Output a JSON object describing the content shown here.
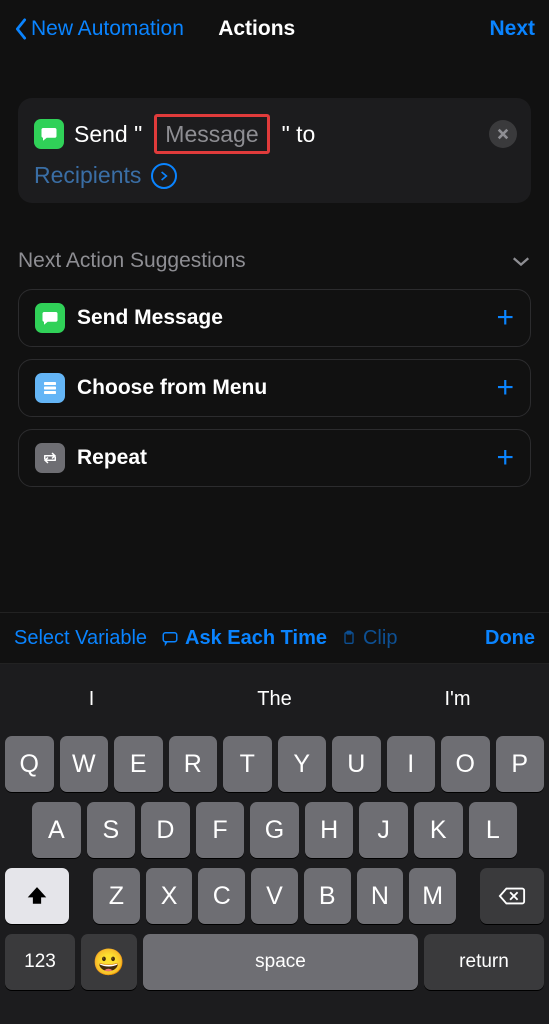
{
  "nav": {
    "back": "New Automation",
    "title": "Actions",
    "next": "Next"
  },
  "action": {
    "prefix": "Send \"",
    "placeholder": "Message",
    "suffix": "\" to",
    "recipients": "Recipients"
  },
  "suggestions": {
    "header": "Next Action Suggestions",
    "items": [
      {
        "label": "Send Message"
      },
      {
        "label": "Choose from Menu"
      },
      {
        "label": "Repeat"
      }
    ]
  },
  "varbar": {
    "select": "Select Variable",
    "ask": "Ask Each Time",
    "clip": "Clip",
    "done": "Done"
  },
  "keyboard": {
    "predictions": [
      "I",
      "The",
      "I'm"
    ],
    "row1": [
      "Q",
      "W",
      "E",
      "R",
      "T",
      "Y",
      "U",
      "I",
      "O",
      "P"
    ],
    "row2": [
      "A",
      "S",
      "D",
      "F",
      "G",
      "H",
      "J",
      "K",
      "L"
    ],
    "row3": [
      "Z",
      "X",
      "C",
      "V",
      "B",
      "N",
      "M"
    ],
    "numKey": "123",
    "space": "space",
    "return": "return"
  }
}
